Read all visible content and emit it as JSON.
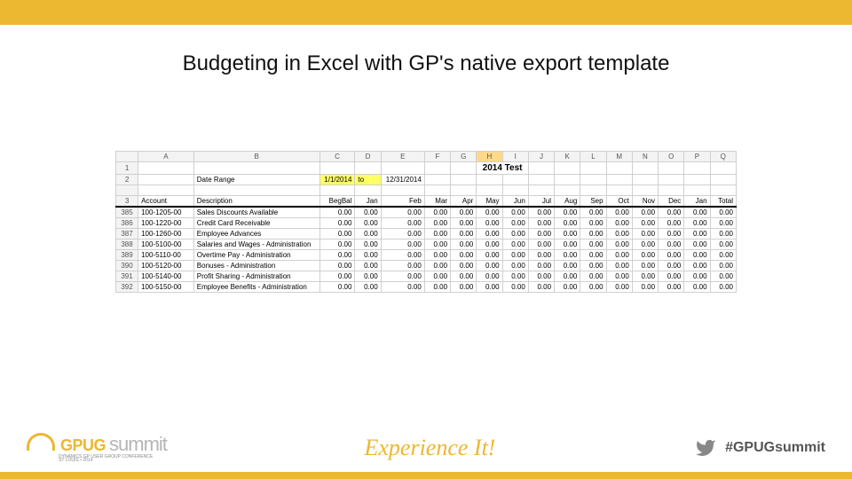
{
  "slide": {
    "title": "Budgeting in Excel with GP's native export template"
  },
  "sheet": {
    "columns": [
      "",
      "A",
      "B",
      "C",
      "D",
      "E",
      "F",
      "G",
      "H",
      "I",
      "J",
      "K",
      "L",
      "M",
      "N",
      "O",
      "P",
      "Q"
    ],
    "selected_col": "H",
    "title_text": "2014 Test",
    "row1_num": "1",
    "row2_num": "2",
    "row3_num": "3",
    "date_range_label": "Date Range",
    "date_start": "1/1/2014",
    "date_to": "to",
    "date_end": "12/31/2014",
    "headers": [
      "Account",
      "Description",
      "BegBal",
      "Jan",
      "Feb",
      "Mar",
      "Apr",
      "May",
      "Jun",
      "Jul",
      "Aug",
      "Sep",
      "Oct",
      "Nov",
      "Dec",
      "Jan",
      "Total"
    ],
    "rows": [
      {
        "n": "385",
        "acct": "100-1205-00",
        "desc": "Sales Discounts Available"
      },
      {
        "n": "386",
        "acct": "100-1220-00",
        "desc": "Credit Card Receivable"
      },
      {
        "n": "387",
        "acct": "100-1260-00",
        "desc": "Employee Advances"
      },
      {
        "n": "388",
        "acct": "100-5100-00",
        "desc": "Salaries and Wages - Administration"
      },
      {
        "n": "389",
        "acct": "100-5110-00",
        "desc": "Overtime Pay - Administration"
      },
      {
        "n": "390",
        "acct": "100-5120-00",
        "desc": "Bonuses - Administration"
      },
      {
        "n": "391",
        "acct": "100-5140-00",
        "desc": "Profit Sharing - Administration"
      },
      {
        "n": "392",
        "acct": "100-5150-00",
        "desc": "Employee Benefits - Administration"
      }
    ],
    "zero": "0.00"
  },
  "footer": {
    "logo_brand": "GPUG",
    "logo_word": "summit",
    "logo_sub": "DYNAMICS GP USER GROUP CONFERENCE",
    "logo_loc": "ST LOUIS • 2014",
    "tagline": "Experience It!",
    "hashtag": "#GPUGsummit"
  }
}
